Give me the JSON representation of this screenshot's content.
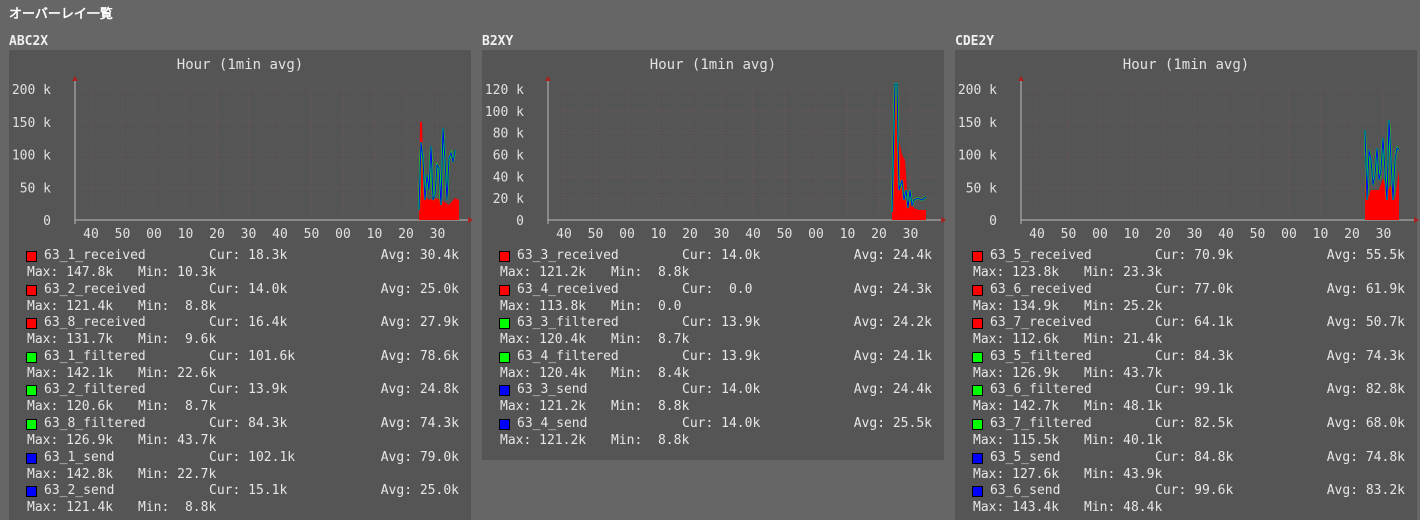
{
  "page_title": "オーバーレイ一覧",
  "panels": [
    {
      "title": "ABC2X",
      "chart_title": "Hour (1min avg)",
      "y_ticks": [
        "200 k",
        "150 k",
        "100 k",
        "50 k",
        "0"
      ],
      "x_ticks": [
        "40",
        "50",
        "00",
        "10",
        "20",
        "30",
        "40",
        "50",
        "00",
        "10",
        "20",
        "30"
      ],
      "legend": [
        {
          "name": "63_1_received",
          "color": "#ff0000",
          "cur": "Cur: 18.3k",
          "avg": "Avg: 30.4k",
          "max": "Max: 147.8k",
          "min": "Min: 10.3k"
        },
        {
          "name": "63_2_received",
          "color": "#ff0000",
          "cur": "Cur: 14.0k",
          "avg": "Avg: 25.0k",
          "max": "Max: 121.4k",
          "min": "Min:  8.8k"
        },
        {
          "name": "63_8_received",
          "color": "#ff0000",
          "cur": "Cur: 16.4k",
          "avg": "Avg: 27.9k",
          "max": "Max: 131.7k",
          "min": "Min:  9.6k"
        },
        {
          "name": "63_1_filtered",
          "color": "#00ff00",
          "cur": "Cur: 101.6k",
          "avg": "Avg: 78.6k",
          "max": "Max: 142.1k",
          "min": "Min: 22.6k"
        },
        {
          "name": "63_2_filtered",
          "color": "#00ff00",
          "cur": "Cur: 13.9k",
          "avg": "Avg: 24.8k",
          "max": "Max: 120.6k",
          "min": "Min:  8.7k"
        },
        {
          "name": "63_8_filtered",
          "color": "#00ff00",
          "cur": "Cur: 84.3k",
          "avg": "Avg: 74.3k",
          "max": "Max: 126.9k",
          "min": "Min: 43.7k"
        },
        {
          "name": "63_1_send",
          "color": "#0000ff",
          "cur": "Cur: 102.1k",
          "avg": "Avg: 79.0k",
          "max": "Max: 142.8k",
          "min": "Min: 22.7k"
        },
        {
          "name": "63_2_send",
          "color": "#0000ff",
          "cur": "Cur: 15.1k",
          "avg": "Avg: 25.0k",
          "max": "Max: 121.4k",
          "min": "Min:  8.8k"
        }
      ]
    },
    {
      "title": "B2XY",
      "chart_title": "Hour (1min avg)",
      "y_ticks": [
        "120 k",
        "100 k",
        "80 k",
        "60 k",
        "40 k",
        "20 k",
        "0"
      ],
      "x_ticks": [
        "40",
        "50",
        "00",
        "10",
        "20",
        "30",
        "40",
        "50",
        "00",
        "10",
        "20",
        "30"
      ],
      "legend": [
        {
          "name": "63_3_received",
          "color": "#ff0000",
          "cur": "Cur: 14.0k",
          "avg": "Avg: 24.4k",
          "max": "Max: 121.2k",
          "min": "Min:  8.8k"
        },
        {
          "name": "63_4_received",
          "color": "#ff0000",
          "cur": "Cur:  0.0",
          "avg": "Avg: 24.3k",
          "max": "Max: 113.8k",
          "min": "Min:  0.0"
        },
        {
          "name": "63_3_filtered",
          "color": "#00ff00",
          "cur": "Cur: 13.9k",
          "avg": "Avg: 24.2k",
          "max": "Max: 120.4k",
          "min": "Min:  8.7k"
        },
        {
          "name": "63_4_filtered",
          "color": "#00ff00",
          "cur": "Cur: 13.9k",
          "avg": "Avg: 24.1k",
          "max": "Max: 120.4k",
          "min": "Min:  8.4k"
        },
        {
          "name": "63_3_send",
          "color": "#0000ff",
          "cur": "Cur: 14.0k",
          "avg": "Avg: 24.4k",
          "max": "Max: 121.2k",
          "min": "Min:  8.8k"
        },
        {
          "name": "63_4_send",
          "color": "#0000ff",
          "cur": "Cur: 14.0k",
          "avg": "Avg: 25.5k",
          "max": "Max: 121.2k",
          "min": "Min:  8.8k"
        }
      ]
    },
    {
      "title": "CDE2Y",
      "chart_title": "Hour (1min avg)",
      "y_ticks": [
        "200 k",
        "150 k",
        "100 k",
        "50 k",
        "0"
      ],
      "x_ticks": [
        "40",
        "50",
        "00",
        "10",
        "20",
        "30",
        "40",
        "50",
        "00",
        "10",
        "20",
        "30"
      ],
      "legend": [
        {
          "name": "63_5_received",
          "color": "#ff0000",
          "cur": "Cur: 70.9k",
          "avg": "Avg: 55.5k",
          "max": "Max: 123.8k",
          "min": "Min: 23.3k"
        },
        {
          "name": "63_6_received",
          "color": "#ff0000",
          "cur": "Cur: 77.0k",
          "avg": "Avg: 61.9k",
          "max": "Max: 134.9k",
          "min": "Min: 25.2k"
        },
        {
          "name": "63_7_received",
          "color": "#ff0000",
          "cur": "Cur: 64.1k",
          "avg": "Avg: 50.7k",
          "max": "Max: 112.6k",
          "min": "Min: 21.4k"
        },
        {
          "name": "63_5_filtered",
          "color": "#00ff00",
          "cur": "Cur: 84.3k",
          "avg": "Avg: 74.3k",
          "max": "Max: 126.9k",
          "min": "Min: 43.7k"
        },
        {
          "name": "63_6_filtered",
          "color": "#00ff00",
          "cur": "Cur: 99.1k",
          "avg": "Avg: 82.8k",
          "max": "Max: 142.7k",
          "min": "Min: 48.1k"
        },
        {
          "name": "63_7_filtered",
          "color": "#00ff00",
          "cur": "Cur: 82.5k",
          "avg": "Avg: 68.0k",
          "max": "Max: 115.5k",
          "min": "Min: 40.1k"
        },
        {
          "name": "63_5_send",
          "color": "#0000ff",
          "cur": "Cur: 84.8k",
          "avg": "Avg: 74.8k",
          "max": "Max: 127.6k",
          "min": "Min: 43.9k"
        },
        {
          "name": "63_6_send",
          "color": "#0000ff",
          "cur": "Cur: 99.6k",
          "avg": "Avg: 83.2k",
          "max": "Max: 143.4k",
          "min": "Min: 48.4k"
        }
      ]
    }
  ]
}
